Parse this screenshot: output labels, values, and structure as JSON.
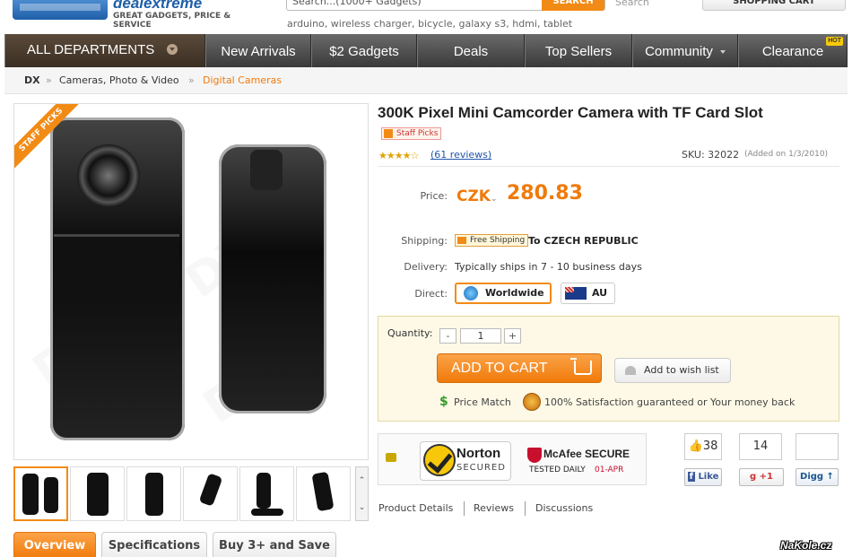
{
  "header": {
    "logo_word": "dealextreme",
    "logo_tagline": "GREAT GADGETS, PRICE & SERVICE",
    "search_value": "Search...(1000+ Gadgets)",
    "search_button": "SEARCH",
    "search_label": "Search",
    "popular_searches": "arduino, wireless charger, bicycle, galaxy s3, hdmi, tablet",
    "cart_label": "SHOPPING CART"
  },
  "nav": {
    "departments": "ALL DEPARTMENTS",
    "items": [
      "New Arrivals",
      "$2 Gadgets",
      "Deals",
      "Top Sellers",
      "Community",
      "Clearance"
    ],
    "hot_badge": "HOT"
  },
  "breadcrumb": [
    "DX",
    "Cameras, Photo & Video",
    "Digital Cameras"
  ],
  "breadcrumb_separator": "»",
  "gallery": {
    "ribbon": "STAFF PICKS",
    "scroll_up": "⌃",
    "scroll_down": "⌄",
    "active_thumb": 1
  },
  "product": {
    "title": "300K Pixel Mini Camcorder Camera with TF Card Slot",
    "badge": "Staff Picks",
    "rating_stars": "★★★★☆",
    "rating": 4,
    "reviews": "(61 reviews)",
    "sku": "SKU: 32022",
    "added": "(Added on 1/3/2010)",
    "price_label": "Price:",
    "currency": "CZK",
    "currency_arrow": "⌄",
    "price": "280.83",
    "shipping_label": "Shipping:",
    "free_shipping": "Free Shipping",
    "ship_to": "To CZECH REPUBLIC",
    "delivery_label": "Delivery:",
    "delivery": "Typically ships in 7 - 10 business days",
    "direct_label": "Direct:",
    "warehouse_worldwide": "Worldwide",
    "warehouse_au": "AU"
  },
  "cart": {
    "quantity_label": "Quantity:",
    "minus": "-",
    "quantity": "1",
    "plus": "+",
    "add_to_cart": "ADD TO CART",
    "wish_list": "Add to wish list",
    "price_match_icon": "$",
    "price_match": "Price Match",
    "satisfaction": "100% Satisfaction guaranteed or Your money back"
  },
  "trust": {
    "norton_title": "Norton",
    "norton_sub": "SECURED",
    "mcafee_title": "McAfee SECURE",
    "mcafee_sub": "TESTED DAILY",
    "mcafee_date": "01-APR"
  },
  "social": {
    "fb_count": "38",
    "fb_label": "Like",
    "gplus_count": "14",
    "gplus_label": "+1",
    "digg_label": "Digg"
  },
  "detail_tabs": [
    "Product Details",
    "Reviews",
    "Discussions"
  ],
  "bottom_tabs": [
    "Overview",
    "Specifications",
    "Buy 3+ and Save"
  ],
  "watermark": "NaKole.cz",
  "colors": {
    "accent": "#f07a0a",
    "nav": "#4a4a4a",
    "link": "#2255aa"
  }
}
